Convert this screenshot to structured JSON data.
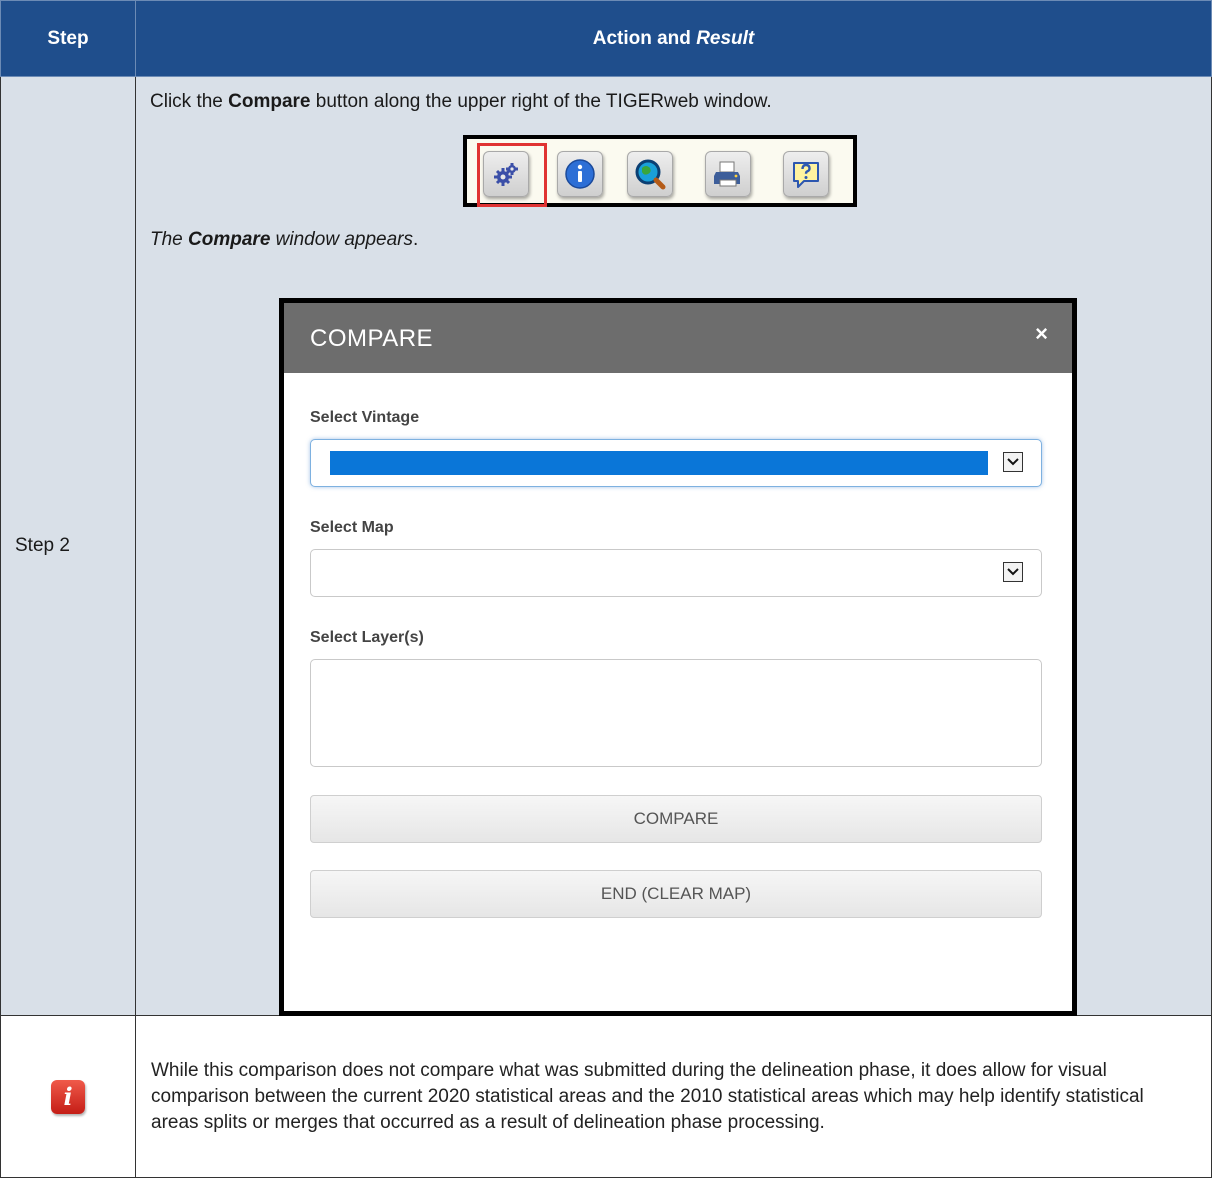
{
  "table": {
    "header": {
      "step": "Step",
      "action_prefix": "Action and ",
      "action_emph": "Result"
    },
    "step_row": {
      "label": "Step 2",
      "instruction": {
        "before": "Click the ",
        "bold": "Compare",
        "after": " button along the upper right of the TIGERweb window."
      },
      "toolbar": {
        "buttons": [
          "compare-icon",
          "info-icon",
          "zoom-icon",
          "print-icon",
          "help-icon"
        ],
        "highlighted": "compare-icon",
        "highlight_color": "#e03333"
      },
      "result": {
        "before": "The ",
        "bold": "Compare",
        "after": " window appears",
        "trail": "."
      },
      "dialog": {
        "title": "COMPARE",
        "close": "×",
        "vintage_label": "Select Vintage",
        "map_label": "Select Map",
        "layers_label": "Select Layer(s)",
        "compare_button": "COMPARE",
        "end_button": "END (CLEAR MAP)",
        "selected_color": "#0a76d8"
      }
    },
    "note_row": {
      "icon": "info-icon",
      "text": "While this comparison does not compare what was submitted during the delineation phase, it does allow for visual comparison between the current 2020 statistical areas and the 2010 statistical areas which may help identify statistical areas splits or merges that occurred as a result of delineation phase processing."
    }
  },
  "colors": {
    "header_bg": "#1f4e8c",
    "step_row_bg": "#d9e0e8",
    "dialog_header_bg": "#6d6d6d"
  }
}
